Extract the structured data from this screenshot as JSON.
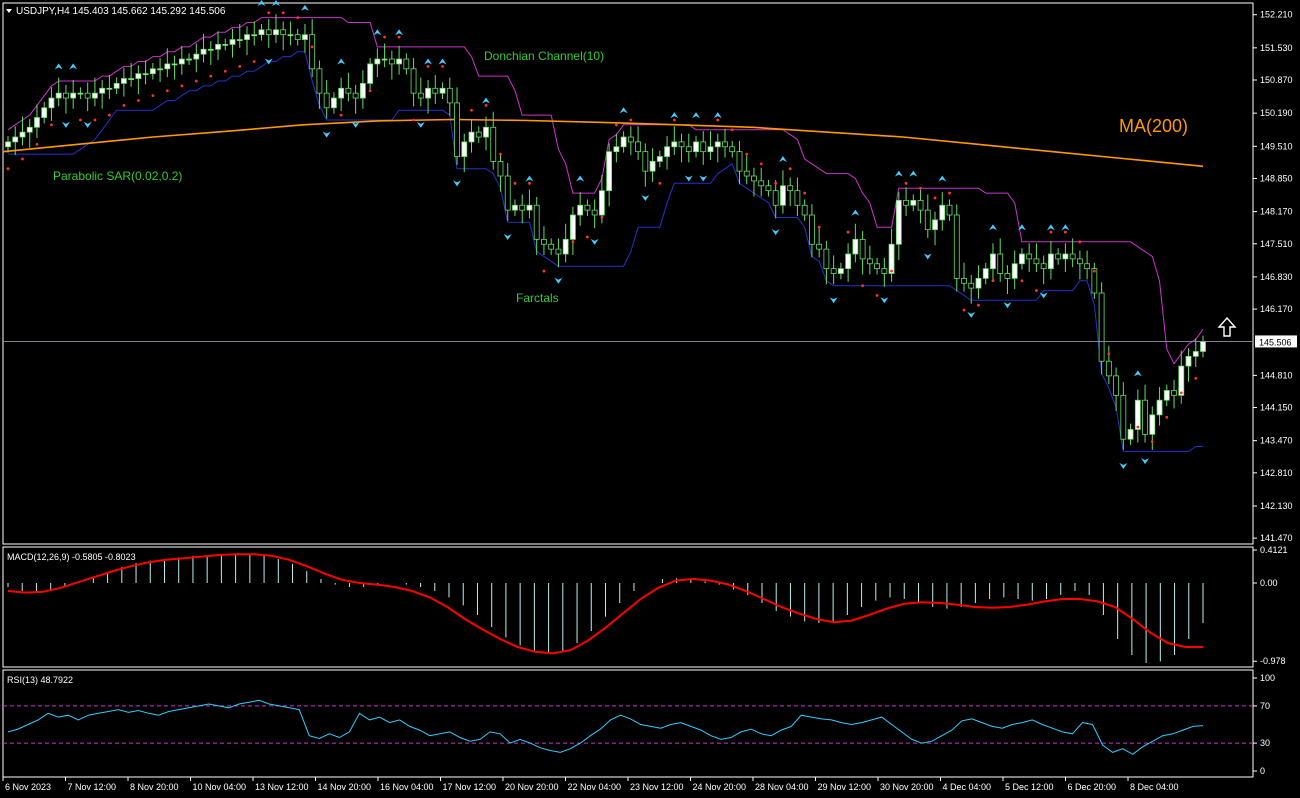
{
  "header": {
    "symbol_line": "USDJPY,H4  145.403 145.662 145.292 145.506"
  },
  "labels": {
    "donchian": "Donchian Channel(10)",
    "ma": "MA(200)",
    "sar": "Parabolic SAR(0.02,0.2)",
    "fractals": "Farctals",
    "macd": "MACD(12,26,9) -0.5805 -0.8023",
    "rsi": "RSI(13) 48.7922"
  },
  "colors": {
    "background": "#000000",
    "axis": "#ffffff",
    "bull_candle": "#ffffff",
    "bear_candle": "#000000",
    "wick": "#66dd66",
    "donchian_upper": "#cc33cc",
    "donchian_lower": "#2233cc",
    "ma": "#ff9900",
    "sar": "#ff3333",
    "fractal": "#44ccff",
    "label_green": "#33cc33",
    "macd_hist": "#bbeeee",
    "macd_signal": "#ff0000",
    "rsi_line": "#33ccff",
    "rsi_level": "#cc33cc",
    "price_line": "#8899aa",
    "price_box_bg": "#ffffff",
    "price_box_text": "#000000"
  },
  "icons": {
    "arrow": "up-arrow-icon",
    "dropdown": "triangle-down-icon"
  },
  "chart_data": {
    "type": "candlestick",
    "price_axis_ticks": [
      "152.210",
      "151.530",
      "150.870",
      "150.190",
      "149.510",
      "148.850",
      "148.170",
      "147.510",
      "146.830",
      "146.170",
      "145.506",
      "144.810",
      "144.150",
      "143.470",
      "142.810",
      "142.130",
      "141.470"
    ],
    "price_ylim": [
      141.35,
      152.45
    ],
    "current_price": "145.506",
    "time_axis_ticks": [
      "6 Nov 2023",
      "7 Nov 12:00",
      "8 Nov 20:00",
      "10 Nov 04:00",
      "13 Nov 12:00",
      "14 Nov 20:00",
      "16 Nov 04:00",
      "17 Nov 12:00",
      "20 Nov 20:00",
      "22 Nov 04:00",
      "23 Nov 12:00",
      "24 Nov 20:00",
      "28 Nov 04:00",
      "29 Nov 12:00",
      "30 Nov 20:00",
      "4 Dec 04:00",
      "5 Dec 12:00",
      "6 Dec 20:00",
      "8 Dec 04:00"
    ],
    "close": [
      149.6,
      149.7,
      149.8,
      149.9,
      150.1,
      150.3,
      150.5,
      150.6,
      150.5,
      150.6,
      150.6,
      150.5,
      150.6,
      150.7,
      150.7,
      150.8,
      150.9,
      150.9,
      151.0,
      151.0,
      151.1,
      151.1,
      151.2,
      151.2,
      151.3,
      151.3,
      151.4,
      151.5,
      151.5,
      151.6,
      151.6,
      151.7,
      151.7,
      151.8,
      151.8,
      151.9,
      151.8,
      151.9,
      151.8,
      151.8,
      151.7,
      151.8,
      151.1,
      150.6,
      150.3,
      150.5,
      150.7,
      150.6,
      150.5,
      150.8,
      151.2,
      151.3,
      151.3,
      151.2,
      151.3,
      151.1,
      150.6,
      150.5,
      150.7,
      150.6,
      150.7,
      150.4,
      149.3,
      149.6,
      149.8,
      149.7,
      149.9,
      149.2,
      148.9,
      148.2,
      148.3,
      148.2,
      148.3,
      147.6,
      147.5,
      147.4,
      147.3,
      147.6,
      148.1,
      148.3,
      148.2,
      148.1,
      148.6,
      149.4,
      149.5,
      149.7,
      149.6,
      149.4,
      149.0,
      149.2,
      149.3,
      149.5,
      149.6,
      149.5,
      149.4,
      149.6,
      149.4,
      149.5,
      149.6,
      149.5,
      149.4,
      149.0,
      148.9,
      148.8,
      148.7,
      148.6,
      148.3,
      148.7,
      148.6,
      148.3,
      148.1,
      147.5,
      147.4,
      147.0,
      146.9,
      147.0,
      147.3,
      147.6,
      147.2,
      147.1,
      147.0,
      146.9,
      147.5,
      148.4,
      148.3,
      148.4,
      148.2,
      147.8,
      148.0,
      148.3,
      148.1,
      146.8,
      146.7,
      146.6,
      146.8,
      147.0,
      147.3,
      146.9,
      146.8,
      147.1,
      147.3,
      147.2,
      147.1,
      147.0,
      147.3,
      147.2,
      147.3,
      147.2,
      147.1,
      147.0,
      146.5,
      145.1,
      144.8,
      144.4,
      143.5,
      143.7,
      144.3,
      143.6,
      144.0,
      144.3,
      144.5,
      144.4,
      145.0,
      145.2,
      145.3,
      145.506
    ],
    "ma200": [
      149.4,
      149.55,
      149.7,
      149.82,
      149.95,
      150.03,
      150.06,
      150.04,
      150.0,
      149.95,
      149.9,
      149.8,
      149.7,
      149.55,
      149.4,
      149.25,
      149.1
    ],
    "macd_axis_ticks": [
      "0.4121",
      "0.00",
      "-0.978"
    ],
    "macd_ylim": [
      -1.05,
      0.45
    ],
    "macd_value": -0.5805,
    "macd_signal_value": -0.8023,
    "macd_hist": [
      -0.05,
      -0.1,
      -0.12,
      -0.1,
      -0.05,
      0.02,
      0.08,
      0.14,
      0.2,
      0.25,
      0.28,
      0.3,
      0.32,
      0.34,
      0.35,
      0.36,
      0.37,
      0.36,
      0.34,
      0.3,
      0.24,
      0.15,
      0.05,
      -0.02,
      -0.05,
      -0.05,
      -0.02,
      0.0,
      -0.02,
      -0.05,
      -0.1,
      -0.18,
      -0.28,
      -0.4,
      -0.55,
      -0.68,
      -0.78,
      -0.85,
      -0.88,
      -0.85,
      -0.75,
      -0.6,
      -0.42,
      -0.25,
      -0.1,
      0.0,
      0.05,
      0.06,
      0.05,
      0.02,
      -0.02,
      -0.08,
      -0.15,
      -0.25,
      -0.35,
      -0.42,
      -0.48,
      -0.5,
      -0.48,
      -0.4,
      -0.3,
      -0.22,
      -0.18,
      -0.2,
      -0.25,
      -0.3,
      -0.32,
      -0.3,
      -0.25,
      -0.2,
      -0.18,
      -0.2,
      -0.22,
      -0.2,
      -0.15,
      -0.1,
      -0.15,
      -0.4,
      -0.7,
      -0.9,
      -1.0,
      -0.98,
      -0.9,
      -0.7,
      -0.5
    ],
    "macd_signal": [
      -0.1,
      -0.12,
      -0.11,
      -0.06,
      0.01,
      0.08,
      0.15,
      0.21,
      0.26,
      0.29,
      0.31,
      0.33,
      0.35,
      0.36,
      0.36,
      0.34,
      0.29,
      0.21,
      0.12,
      0.04,
      0.0,
      -0.02,
      -0.05,
      -0.1,
      -0.18,
      -0.3,
      -0.45,
      -0.58,
      -0.7,
      -0.8,
      -0.86,
      -0.88,
      -0.84,
      -0.72,
      -0.56,
      -0.38,
      -0.2,
      -0.06,
      0.03,
      0.05,
      0.03,
      -0.02,
      -0.1,
      -0.2,
      -0.3,
      -0.38,
      -0.45,
      -0.49,
      -0.47,
      -0.4,
      -0.32,
      -0.26,
      -0.24,
      -0.25,
      -0.27,
      -0.3,
      -0.31,
      -0.3,
      -0.27,
      -0.23,
      -0.2,
      -0.2,
      -0.23,
      -0.3,
      -0.45,
      -0.62,
      -0.75,
      -0.8,
      -0.8
    ],
    "rsi_axis_ticks": [
      "100",
      "70",
      "30",
      "0"
    ],
    "rsi_ylim": [
      0,
      100
    ],
    "rsi_levels": [
      70,
      30
    ],
    "rsi_value": 48.7922,
    "rsi": [
      42,
      45,
      50,
      55,
      62,
      58,
      60,
      55,
      60,
      62,
      64,
      66,
      63,
      65,
      62,
      60,
      64,
      66,
      68,
      70,
      72,
      70,
      68,
      72,
      74,
      76,
      72,
      70,
      68,
      66,
      38,
      35,
      40,
      36,
      42,
      62,
      55,
      58,
      52,
      55,
      48,
      44,
      38,
      40,
      42,
      36,
      32,
      34,
      42,
      40,
      30,
      34,
      30,
      25,
      22,
      20,
      24,
      30,
      38,
      45,
      55,
      60,
      56,
      50,
      48,
      46,
      50,
      52,
      48,
      44,
      38,
      34,
      36,
      42,
      45,
      40,
      38,
      44,
      48,
      60,
      58,
      56,
      55,
      52,
      50,
      52,
      55,
      58,
      50,
      42,
      34,
      30,
      32,
      38,
      44,
      54,
      56,
      52,
      48,
      46,
      50,
      52,
      55,
      50,
      46,
      42,
      40,
      52,
      50,
      28,
      20,
      24,
      18,
      26,
      32,
      38,
      40,
      44,
      48,
      48.79
    ]
  }
}
